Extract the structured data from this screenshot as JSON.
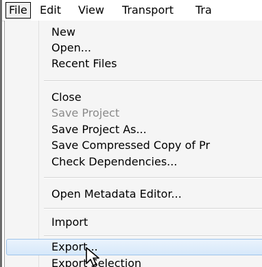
{
  "menubar": {
    "menus": [
      {
        "label": "File",
        "active": true
      },
      {
        "label": "Edit"
      },
      {
        "label": "View"
      },
      {
        "label": "Transport"
      },
      {
        "label": "Tra"
      }
    ]
  },
  "file_menu": {
    "items": [
      {
        "label": "New",
        "enabled": true
      },
      {
        "label": "Open...",
        "enabled": true
      },
      {
        "label": "Recent Files",
        "enabled": true
      },
      {
        "label": "Close",
        "enabled": true
      },
      {
        "label": "Save Project",
        "enabled": false
      },
      {
        "label": "Save Project As...",
        "enabled": true
      },
      {
        "label": "Save Compressed Copy of Pr",
        "enabled": true
      },
      {
        "label": "Check Dependencies...",
        "enabled": true
      },
      {
        "label": "Open Metadata Editor...",
        "enabled": true
      },
      {
        "label": "Import",
        "enabled": true
      },
      {
        "label": "Export...",
        "enabled": true,
        "highlighted": true
      },
      {
        "label": "Export Selection",
        "enabled": true
      }
    ]
  },
  "colors": {
    "highlight_border": "#9ec3ea",
    "disabled_text": "#8a8a8a"
  },
  "cursor": {
    "icon": "arrow-pointer-icon"
  }
}
